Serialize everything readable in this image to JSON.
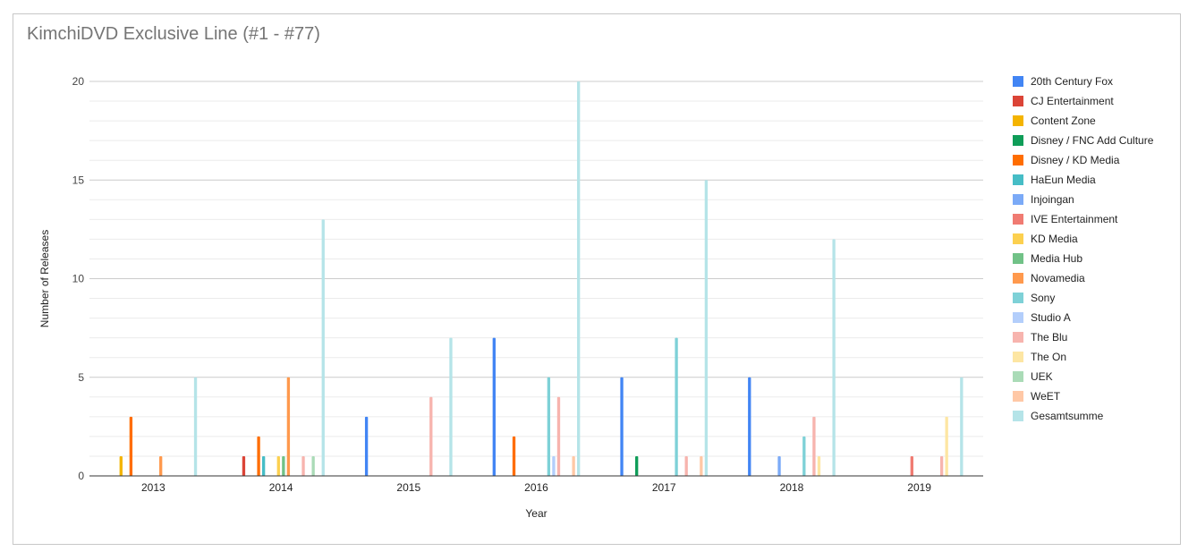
{
  "chart_data": {
    "type": "bar",
    "title": "KimchiDVD Exclusive Line (#1 - #77)",
    "xlabel": "Year",
    "ylabel": "Number of Releases",
    "ylim": [
      0,
      20
    ],
    "yticks": [
      0,
      5,
      10,
      15,
      20
    ],
    "grid": true,
    "legend_position": "right",
    "categories": [
      "2013",
      "2014",
      "2015",
      "2016",
      "2017",
      "2018",
      "2019"
    ],
    "series": [
      {
        "name": "20th Century Fox",
        "color": "#4285f4",
        "values": [
          0,
          0,
          3,
          7,
          5,
          5,
          0
        ]
      },
      {
        "name": "CJ Entertainment",
        "color": "#db4437",
        "values": [
          0,
          1,
          0,
          0,
          0,
          0,
          0
        ]
      },
      {
        "name": "Content Zone",
        "color": "#f4b400",
        "values": [
          1,
          0,
          0,
          0,
          0,
          0,
          0
        ]
      },
      {
        "name": "Disney / FNC Add Culture",
        "color": "#0f9d58",
        "values": [
          0,
          0,
          0,
          0,
          1,
          0,
          0
        ]
      },
      {
        "name": "Disney / KD Media",
        "color": "#ff6d00",
        "values": [
          3,
          2,
          0,
          2,
          0,
          0,
          0
        ]
      },
      {
        "name": "HaEun Media",
        "color": "#46bdc6",
        "values": [
          0,
          1,
          0,
          0,
          0,
          0,
          0
        ]
      },
      {
        "name": "Injoingan",
        "color": "#7baaf7",
        "values": [
          0,
          0,
          0,
          0,
          0,
          1,
          0
        ]
      },
      {
        "name": "IVE Entertainment",
        "color": "#f07b72",
        "values": [
          0,
          0,
          0,
          0,
          0,
          0,
          1
        ]
      },
      {
        "name": "KD Media",
        "color": "#fcd04f",
        "values": [
          0,
          1,
          0,
          0,
          0,
          0,
          0
        ]
      },
      {
        "name": "Media Hub",
        "color": "#71c287",
        "values": [
          0,
          1,
          0,
          0,
          0,
          0,
          0
        ]
      },
      {
        "name": "Novamedia",
        "color": "#ff994d",
        "values": [
          1,
          5,
          0,
          0,
          0,
          0,
          0
        ]
      },
      {
        "name": "Sony",
        "color": "#7ed1d7",
        "values": [
          0,
          0,
          0,
          5,
          7,
          2,
          0
        ]
      },
      {
        "name": "Studio A",
        "color": "#b3cefb",
        "values": [
          0,
          0,
          0,
          1,
          0,
          0,
          0
        ]
      },
      {
        "name": "The Blu",
        "color": "#f7b4ae",
        "values": [
          0,
          1,
          4,
          4,
          1,
          3,
          1
        ]
      },
      {
        "name": "The On",
        "color": "#fde6a3",
        "values": [
          0,
          0,
          0,
          0,
          0,
          1,
          3
        ]
      },
      {
        "name": "UEK",
        "color": "#aadbb7",
        "values": [
          0,
          1,
          0,
          0,
          0,
          0,
          0
        ]
      },
      {
        "name": "WeET",
        "color": "#ffc8a6",
        "values": [
          0,
          0,
          0,
          1,
          1,
          0,
          0
        ]
      },
      {
        "name": "Gesamtsumme",
        "color": "#b5e4e8",
        "values": [
          5,
          13,
          7,
          20,
          15,
          12,
          5
        ]
      }
    ]
  }
}
